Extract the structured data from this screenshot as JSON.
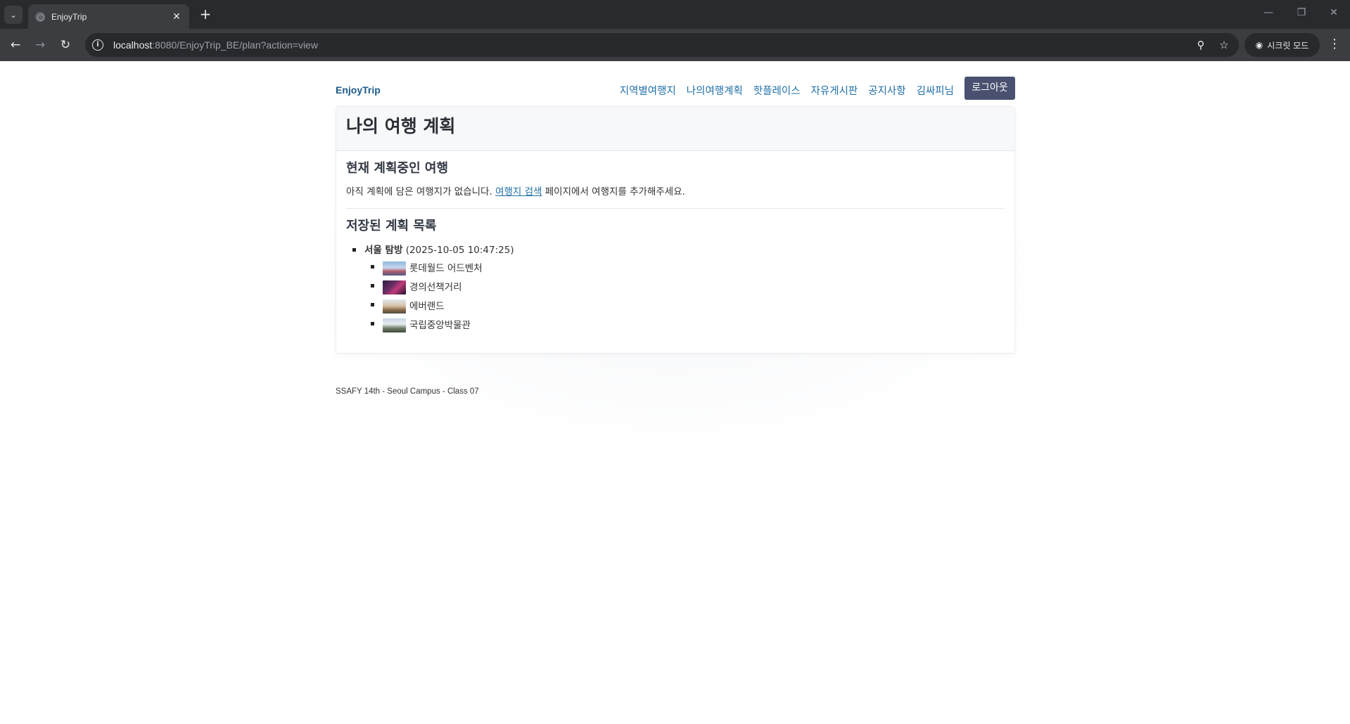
{
  "browser": {
    "tab_title": "EnjoyTrip",
    "url_host": "localhost",
    "url_rest": ":8080/EnjoyTrip_BE/plan?action=view",
    "incognito_label": "시크릿 모드"
  },
  "nav": {
    "brand": "EnjoyTrip",
    "links": [
      "지역별여행지",
      "나의여행계획",
      "핫플레이스",
      "자유게시판",
      "공지사항",
      "김싸피님"
    ],
    "logout": "로그아웃"
  },
  "main": {
    "title": "나의 여행 계획",
    "current_section_title": "현재 계획중인 여행",
    "empty_prefix": "아직 계획에 담은 여행지가 없습니다. ",
    "search_link": "여행지 검색",
    "empty_suffix": " 페이지에서 여행지를 추가해주세요.",
    "saved_section_title": "저장된 계획 목록",
    "plans": [
      {
        "name": "서울 탐방",
        "date": "(2025-10-05 10:47:25)",
        "places": [
          "롯데월드 어드벤처",
          "경의선책거리",
          "에버랜드",
          "국립중앙박물관"
        ]
      }
    ]
  },
  "footer": "SSAFY 14th - Seoul Campus - Class 07"
}
